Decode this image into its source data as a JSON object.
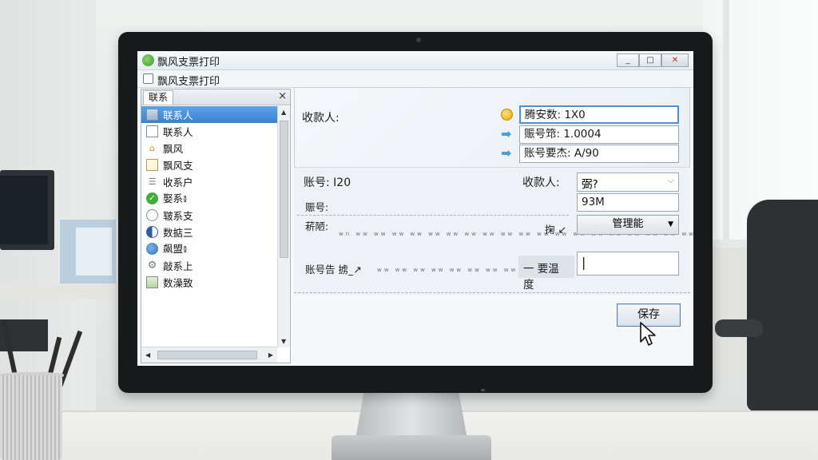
{
  "window": {
    "title": "飘风支票打印",
    "subtitle": "飘风支票打印",
    "buttons": {
      "minimize": "_",
      "maximize": "□",
      "close": "✕"
    }
  },
  "sidebar": {
    "tab_label": "联系",
    "close_glyph": "×",
    "items": [
      {
        "label": "联系人",
        "icon": "grid-icon",
        "selected": true
      },
      {
        "label": "联系人",
        "icon": "document-icon"
      },
      {
        "label": "飘风",
        "icon": "house-icon"
      },
      {
        "label": "飘风支",
        "icon": "note-icon"
      },
      {
        "label": "收系户",
        "icon": "user-icon"
      },
      {
        "label": "娶系៖",
        "icon": "check-icon"
      },
      {
        "label": "皲系支",
        "icon": "circle-icon"
      },
      {
        "label": "数掂三",
        "icon": "half-circle-icon"
      },
      {
        "label": "飙盟៖",
        "icon": "globe-icon"
      },
      {
        "label": "敲系上",
        "icon": "gear-icon"
      },
      {
        "label": "数澡致",
        "icon": "picture-icon"
      }
    ]
  },
  "form": {
    "payee_label": "收款人:",
    "field1_value": "腾安数: 1X0",
    "field2_value": "赈号筇: 1.0004",
    "field3_value": "账号要杰: A/90",
    "account_label": "账号: I20",
    "payee2_label": "收款人:",
    "select_value": "弼?",
    "field4_label": "赈号:",
    "field4_value": "93M",
    "notes_label": "菥陋:",
    "dotted_text": "wn ww ww ww ww ww ww ww ww ww ww ww ww ww ww ww ww ww ww ww ww ww ww ww ww ww",
    "action_label": "掬 ↙",
    "dropdown_label": "管理能",
    "bottom_label": "账号告 掳_↗",
    "bottom_dots": "ww ww ww ww ww ww ww ww ww ww ww ww",
    "amount_label": "一 要温度",
    "amount_value": "|"
  },
  "actions": {
    "save_label": "保存"
  }
}
